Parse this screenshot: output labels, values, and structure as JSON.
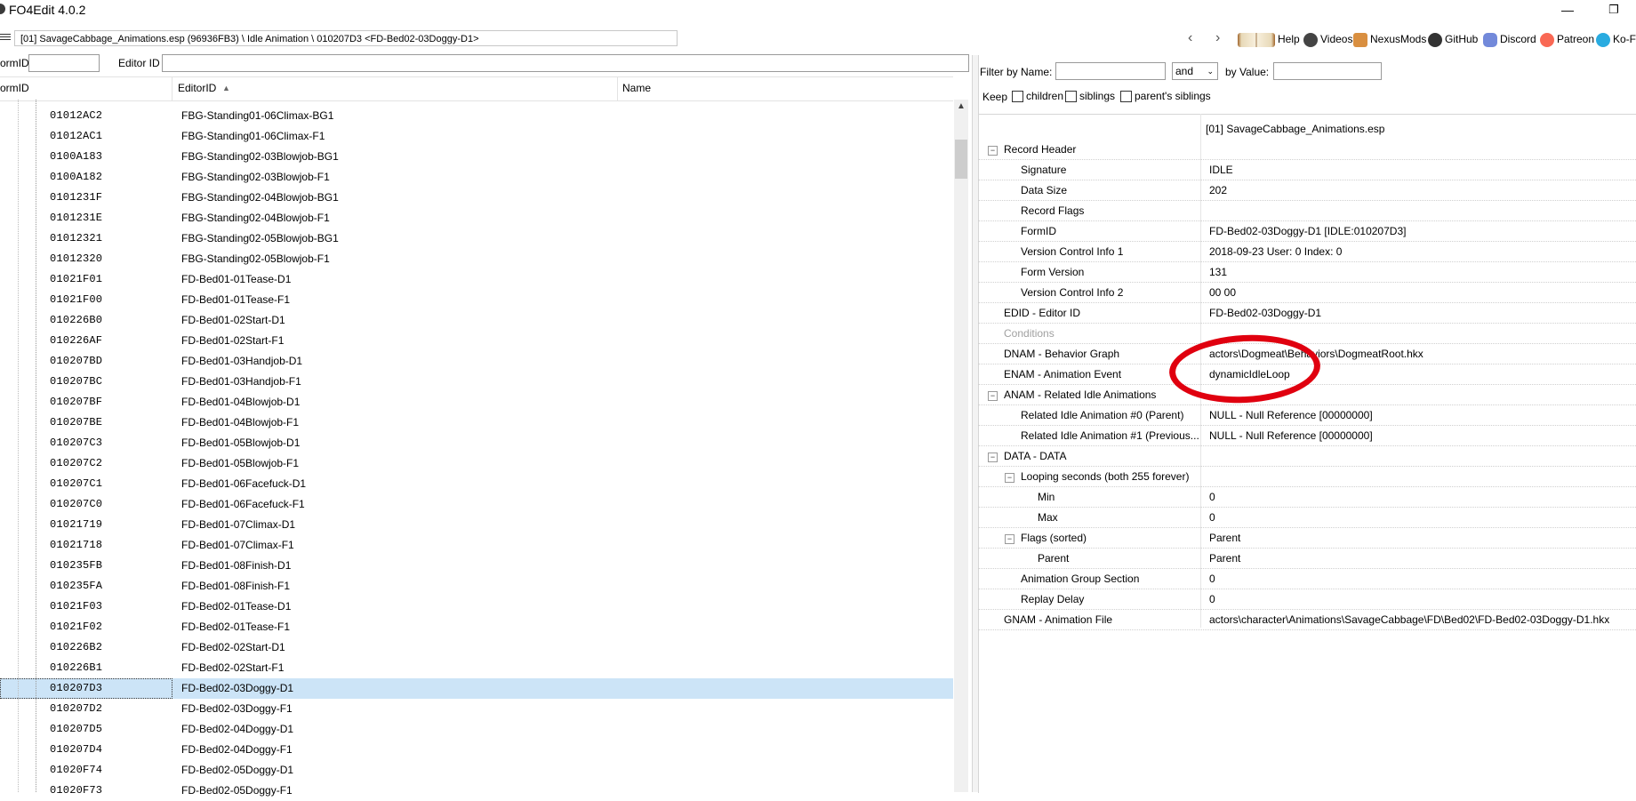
{
  "window": {
    "title": "FO4Edit 4.0.2",
    "minimize": "—",
    "restore": "❐"
  },
  "pathbar": {
    "path": "[01] SavageCabbage_Animations.esp (96936FB3) \\ Idle Animation \\ 010207D3 <FD-Bed02-03Doggy-D1>",
    "back": "‹",
    "forward": "›"
  },
  "toolbar": {
    "help": "Help",
    "videos": "Videos",
    "nexusmods": "NexusMods",
    "github": "GitHub",
    "discord": "Discord",
    "patreon": "Patreon",
    "kofi": "Ko-Fi"
  },
  "left_filter": {
    "formid_label": "ormID",
    "formid_value": "",
    "editorid_label": "Editor ID",
    "editorid_value": ""
  },
  "list": {
    "columns": [
      "ormID",
      "EditorID",
      "Name"
    ],
    "sort_indicator": "▲",
    "rows": [
      {
        "formid": "01012AC2",
        "editorid": "FBG-Standing01-06Climax-BG1"
      },
      {
        "formid": "01012AC1",
        "editorid": "FBG-Standing01-06Climax-F1"
      },
      {
        "formid": "0100A183",
        "editorid": "FBG-Standing02-03Blowjob-BG1"
      },
      {
        "formid": "0100A182",
        "editorid": "FBG-Standing02-03Blowjob-F1"
      },
      {
        "formid": "0101231F",
        "editorid": "FBG-Standing02-04Blowjob-BG1"
      },
      {
        "formid": "0101231E",
        "editorid": "FBG-Standing02-04Blowjob-F1"
      },
      {
        "formid": "01012321",
        "editorid": "FBG-Standing02-05Blowjob-BG1"
      },
      {
        "formid": "01012320",
        "editorid": "FBG-Standing02-05Blowjob-F1"
      },
      {
        "formid": "01021F01",
        "editorid": "FD-Bed01-01Tease-D1"
      },
      {
        "formid": "01021F00",
        "editorid": "FD-Bed01-01Tease-F1"
      },
      {
        "formid": "010226B0",
        "editorid": "FD-Bed01-02Start-D1"
      },
      {
        "formid": "010226AF",
        "editorid": "FD-Bed01-02Start-F1"
      },
      {
        "formid": "010207BD",
        "editorid": "FD-Bed01-03Handjob-D1"
      },
      {
        "formid": "010207BC",
        "editorid": "FD-Bed01-03Handjob-F1"
      },
      {
        "formid": "010207BF",
        "editorid": "FD-Bed01-04Blowjob-D1"
      },
      {
        "formid": "010207BE",
        "editorid": "FD-Bed01-04Blowjob-F1"
      },
      {
        "formid": "010207C3",
        "editorid": "FD-Bed01-05Blowjob-D1"
      },
      {
        "formid": "010207C2",
        "editorid": "FD-Bed01-05Blowjob-F1"
      },
      {
        "formid": "010207C1",
        "editorid": "FD-Bed01-06Facefuck-D1"
      },
      {
        "formid": "010207C0",
        "editorid": "FD-Bed01-06Facefuck-F1"
      },
      {
        "formid": "01021719",
        "editorid": "FD-Bed01-07Climax-D1"
      },
      {
        "formid": "01021718",
        "editorid": "FD-Bed01-07Climax-F1"
      },
      {
        "formid": "010235FB",
        "editorid": "FD-Bed01-08Finish-D1"
      },
      {
        "formid": "010235FA",
        "editorid": "FD-Bed01-08Finish-F1"
      },
      {
        "formid": "01021F03",
        "editorid": "FD-Bed02-01Tease-D1"
      },
      {
        "formid": "01021F02",
        "editorid": "FD-Bed02-01Tease-F1"
      },
      {
        "formid": "010226B2",
        "editorid": "FD-Bed02-02Start-D1"
      },
      {
        "formid": "010226B1",
        "editorid": "FD-Bed02-02Start-F1"
      },
      {
        "formid": "010207D3",
        "editorid": "FD-Bed02-03Doggy-D1",
        "selected": true
      },
      {
        "formid": "010207D2",
        "editorid": "FD-Bed02-03Doggy-F1"
      },
      {
        "formid": "010207D5",
        "editorid": "FD-Bed02-04Doggy-D1"
      },
      {
        "formid": "010207D4",
        "editorid": "FD-Bed02-04Doggy-F1"
      },
      {
        "formid": "01020F74",
        "editorid": "FD-Bed02-05Doggy-D1"
      },
      {
        "formid": "01020F73",
        "editorid": "FD-Bed02-05Doggy-F1"
      }
    ]
  },
  "right_filter": {
    "filter_by_name_label": "Filter by Name:",
    "name_value": "",
    "operator": "and",
    "by_value_label": "by Value:",
    "value_value": "",
    "keep_label": "Keep",
    "children_label": "children",
    "siblings_label": "siblings",
    "parents_siblings_label": "parent's siblings"
  },
  "detail": {
    "file_header": "[01] SavageCabbage_Animations.esp",
    "rows": [
      {
        "label": "Record Header",
        "value": "",
        "indent": 0,
        "expander": "−"
      },
      {
        "label": "Signature",
        "value": "IDLE",
        "indent": 1
      },
      {
        "label": "Data Size",
        "value": "202",
        "indent": 1
      },
      {
        "label": "Record Flags",
        "value": "",
        "indent": 1
      },
      {
        "label": "FormID",
        "value": "FD-Bed02-03Doggy-D1 [IDLE:010207D3]",
        "indent": 1
      },
      {
        "label": "Version Control Info 1",
        "value": "2018-09-23 User: 0 Index: 0",
        "indent": 1
      },
      {
        "label": "Form Version",
        "value": "131",
        "indent": 1
      },
      {
        "label": "Version Control Info 2",
        "value": "00 00",
        "indent": 1
      },
      {
        "label": "EDID - Editor ID",
        "value": "FD-Bed02-03Doggy-D1",
        "indent": 0
      },
      {
        "label": "Conditions",
        "value": "",
        "indent": 0,
        "muted": true
      },
      {
        "label": "DNAM - Behavior Graph",
        "value": "actors\\Dogmeat\\Behaviors\\DogmeatRoot.hkx",
        "indent": 0
      },
      {
        "label": "ENAM - Animation Event",
        "value": "dynamicIdleLoop",
        "indent": 0
      },
      {
        "label": "ANAM - Related Idle Animations",
        "value": "",
        "indent": 0,
        "expander": "−"
      },
      {
        "label": "Related Idle Animation #0 (Parent)",
        "value": "NULL - Null Reference [00000000]",
        "indent": 1
      },
      {
        "label": "Related Idle Animation #1 (Previous...",
        "value": "NULL - Null Reference [00000000]",
        "indent": 1
      },
      {
        "label": "DATA - DATA",
        "value": "",
        "indent": 0,
        "expander": "−"
      },
      {
        "label": "Looping seconds (both 255 forever)",
        "value": "",
        "indent": 1,
        "expander": "−"
      },
      {
        "label": "Min",
        "value": "0",
        "indent": 2
      },
      {
        "label": "Max",
        "value": "0",
        "indent": 2
      },
      {
        "label": "Flags (sorted)",
        "value": "Parent",
        "indent": 1,
        "expander": "−"
      },
      {
        "label": "Parent",
        "value": "Parent",
        "indent": 2
      },
      {
        "label": "Animation Group Section",
        "value": "0",
        "indent": 1
      },
      {
        "label": "Replay Delay",
        "value": "0",
        "indent": 1
      },
      {
        "label": "GNAM - Animation File",
        "value": "actors\\character\\Animations\\SavageCabbage\\FD\\Bed02\\FD-Bed02-03Doggy-D1.hkx",
        "indent": 0
      }
    ]
  },
  "colors": {
    "selection": "#cce4f7",
    "annotation_circle": "#e0000f"
  },
  "icons": {
    "help": "book-icon",
    "videos": "video-icon",
    "nexusmods": "nexus-icon",
    "github": "github-icon",
    "discord": "discord-icon",
    "patreon": "patreon-icon",
    "kofi": "kofi-icon"
  }
}
